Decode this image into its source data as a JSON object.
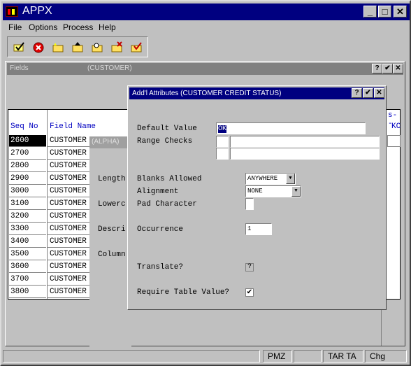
{
  "app": {
    "title": "APPX",
    "caption_minimize": "_",
    "caption_maximize": "□",
    "caption_close": "✕"
  },
  "menu": [
    "File",
    "Options",
    "Process",
    "Help"
  ],
  "toolbar": {
    "icons": [
      "confirm-icon",
      "cancel-icon",
      "folder-star-icon",
      "folder-up-icon",
      "folder-search-icon",
      "folder-delete-icon",
      "folder-check-icon"
    ]
  },
  "fields_window": {
    "title": "Fields",
    "subtitle": "(CUSTOMER)",
    "caption_help": "?",
    "caption_ok": "✔",
    "caption_close": "✕",
    "col_seq": "Seq No",
    "col_name": "Field Name",
    "col_right1": "s--",
    "col_right2": "KC",
    "rows": [
      {
        "seq": "2600",
        "name": "CUSTOMER"
      },
      {
        "seq": "2700",
        "name": "CUSTOMER"
      },
      {
        "seq": "2800",
        "name": "CUSTOMER"
      },
      {
        "seq": "2900",
        "name": "CUSTOMER"
      },
      {
        "seq": "3000",
        "name": "CUSTOMER"
      },
      {
        "seq": "3100",
        "name": "CUSTOMER"
      },
      {
        "seq": "3200",
        "name": "CUSTOMER"
      },
      {
        "seq": "3300",
        "name": "CUSTOMER"
      },
      {
        "seq": "3400",
        "name": "CUSTOMER"
      },
      {
        "seq": "3500",
        "name": "CUSTOMER"
      },
      {
        "seq": "3600",
        "name": "CUSTOMER"
      },
      {
        "seq": "3700",
        "name": "CUSTOMER"
      },
      {
        "seq": "3800",
        "name": "CUSTOMER"
      }
    ],
    "alpha_title": "(ALPHA)",
    "side_labels": [
      "Length",
      "Lowerc",
      "Descri",
      "Column"
    ]
  },
  "dialog": {
    "title": "Add'l Attributes (CUSTOMER CREDIT STATUS)",
    "caption_help": "?",
    "caption_ok": "✔",
    "caption_close": "✕",
    "default_value_label": "Default Value",
    "default_value": "OK",
    "range_checks_label": "Range Checks",
    "blanks_allowed_label": "Blanks Allowed",
    "blanks_allowed_value": "ANYWHERE",
    "alignment_label": "Alignment",
    "alignment_value": "NONE",
    "pad_character_label": "Pad Character",
    "occurrence_label": "Occurrence",
    "occurrence_value": "1",
    "translate_label": "Translate?",
    "translate_value": "?",
    "require_table_label": "Require Table Value?",
    "require_table_checked": "✔"
  },
  "status": [
    "PMZ",
    "TAR TA",
    "Chg"
  ]
}
